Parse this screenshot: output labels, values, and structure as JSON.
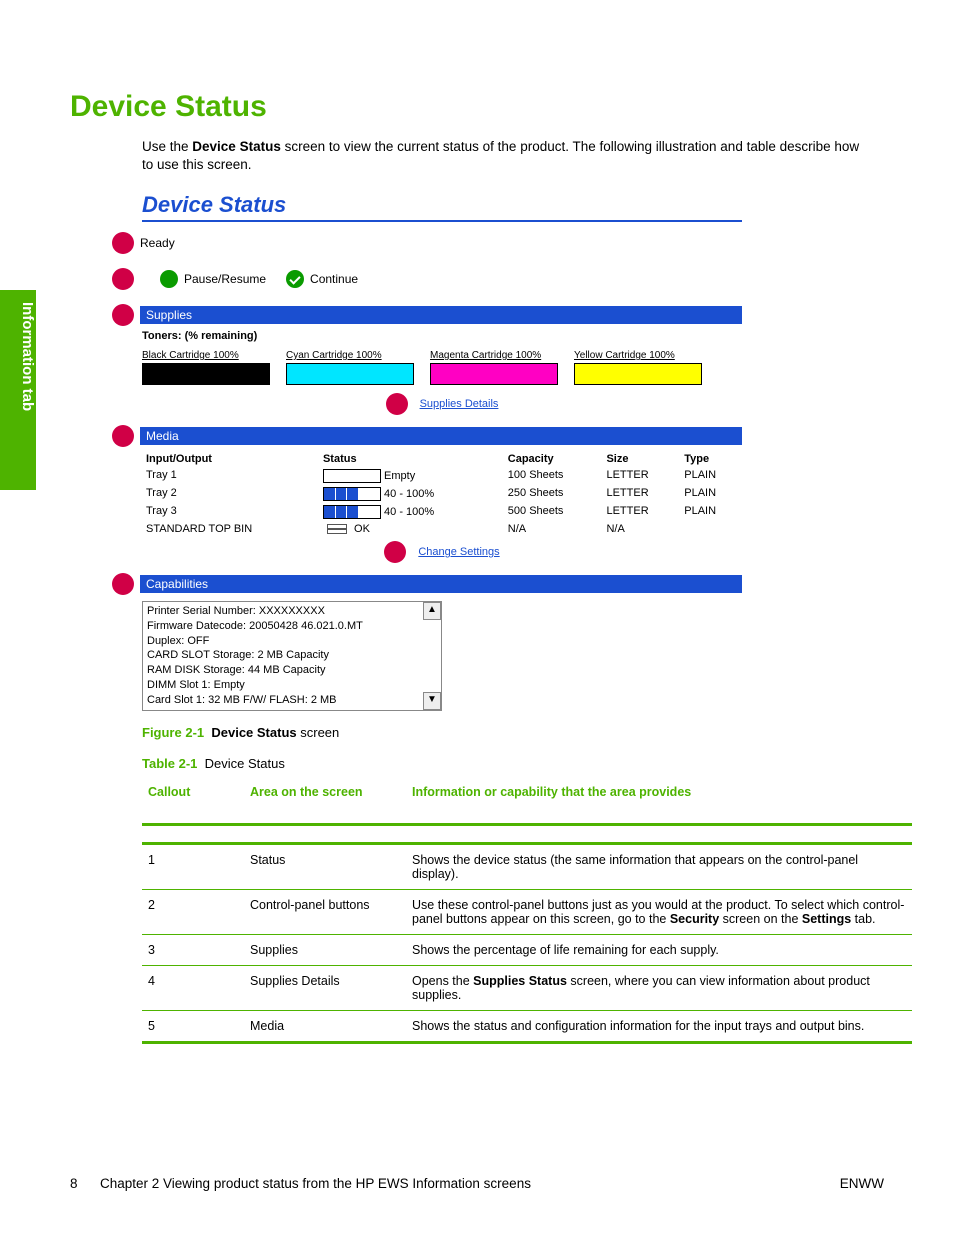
{
  "sideTab": "Information tab",
  "heading": "Device Status",
  "intro": {
    "pre": "Use the ",
    "bold": "Device Status",
    "post": " screen to view the current status of the product. The following illustration and table describe how to use this screen."
  },
  "ds": {
    "title": "Device Status",
    "status": "Ready",
    "btnPause": "Pause/Resume",
    "btnContinue": "Continue",
    "supplies": {
      "bar": "Supplies",
      "sub": "Toners: (% remaining)",
      "black": "Black Cartridge  100%",
      "cyan": "Cyan Cartridge  100%",
      "magenta": "Magenta Cartridge  100%",
      "yellow": "Yellow Cartridge  100%",
      "detailsLink": "Supplies Details"
    },
    "media": {
      "bar": "Media",
      "h1": "Input/Output",
      "h2": "Status",
      "h3": "Capacity",
      "h4": "Size",
      "h5": "Type",
      "r1": {
        "io": "Tray 1",
        "st": "Empty",
        "cap": "100 Sheets",
        "sz": "LETTER",
        "ty": "PLAIN"
      },
      "r2": {
        "io": "Tray 2",
        "st": "40 - 100%",
        "cap": "250 Sheets",
        "sz": "LETTER",
        "ty": "PLAIN"
      },
      "r3": {
        "io": "Tray 3",
        "st": "40 - 100%",
        "cap": "500 Sheets",
        "sz": "LETTER",
        "ty": "PLAIN"
      },
      "r4": {
        "io": "STANDARD TOP BIN",
        "st": "OK",
        "cap": "N/A",
        "sz": "N/A",
        "ty": ""
      },
      "changeLink": "Change Settings"
    },
    "cap": {
      "bar": "Capabilities",
      "l1": "Printer Serial Number: XXXXXXXXX",
      "l2": "Firmware Datecode: 20050428 46.021.0.MT",
      "l3": "Duplex: OFF",
      "l4": "CARD SLOT Storage: 2 MB Capacity",
      "l5": "RAM DISK Storage: 44 MB Capacity",
      "l6": "DIMM Slot 1: Empty",
      "l7": "Card Slot 1: 32 MB F/W/ FLASH: 2 MB"
    }
  },
  "figCaption": {
    "num": "Figure 2-1",
    "boldText": "Device Status",
    "rest": " screen"
  },
  "tabCaption": {
    "num": "Table 2-1",
    "rest": "Device Status"
  },
  "tableHead": {
    "c": "Callout",
    "a": "Area on the screen",
    "i": "Information or capability that the area provides"
  },
  "rows": {
    "r1": {
      "c": "1",
      "a": "Status",
      "i": "Shows the device status (the same information that appears on the control-panel display)."
    },
    "r2": {
      "c": "2",
      "a": "Control-panel buttons",
      "i_pre": "Use these control-panel buttons just as you would at the product. To select which control-panel buttons appear on this screen, go to the ",
      "i_b1": "Security",
      "i_mid": " screen on the ",
      "i_b2": "Settings",
      "i_post": " tab."
    },
    "r3": {
      "c": "3",
      "a": "Supplies",
      "i": "Shows the percentage of life remaining for each supply."
    },
    "r4": {
      "c": "4",
      "a": "Supplies Details",
      "i_pre": "Opens the ",
      "i_b": "Supplies Status",
      "i_post": " screen, where you can view information about product supplies."
    },
    "r5": {
      "c": "5",
      "a": "Media",
      "i": "Shows the status and configuration information for the input trays and output bins."
    }
  },
  "footer": {
    "page": "8",
    "chapter": "Chapter 2    Viewing product status from the HP EWS Information screens",
    "right": "ENWW"
  }
}
